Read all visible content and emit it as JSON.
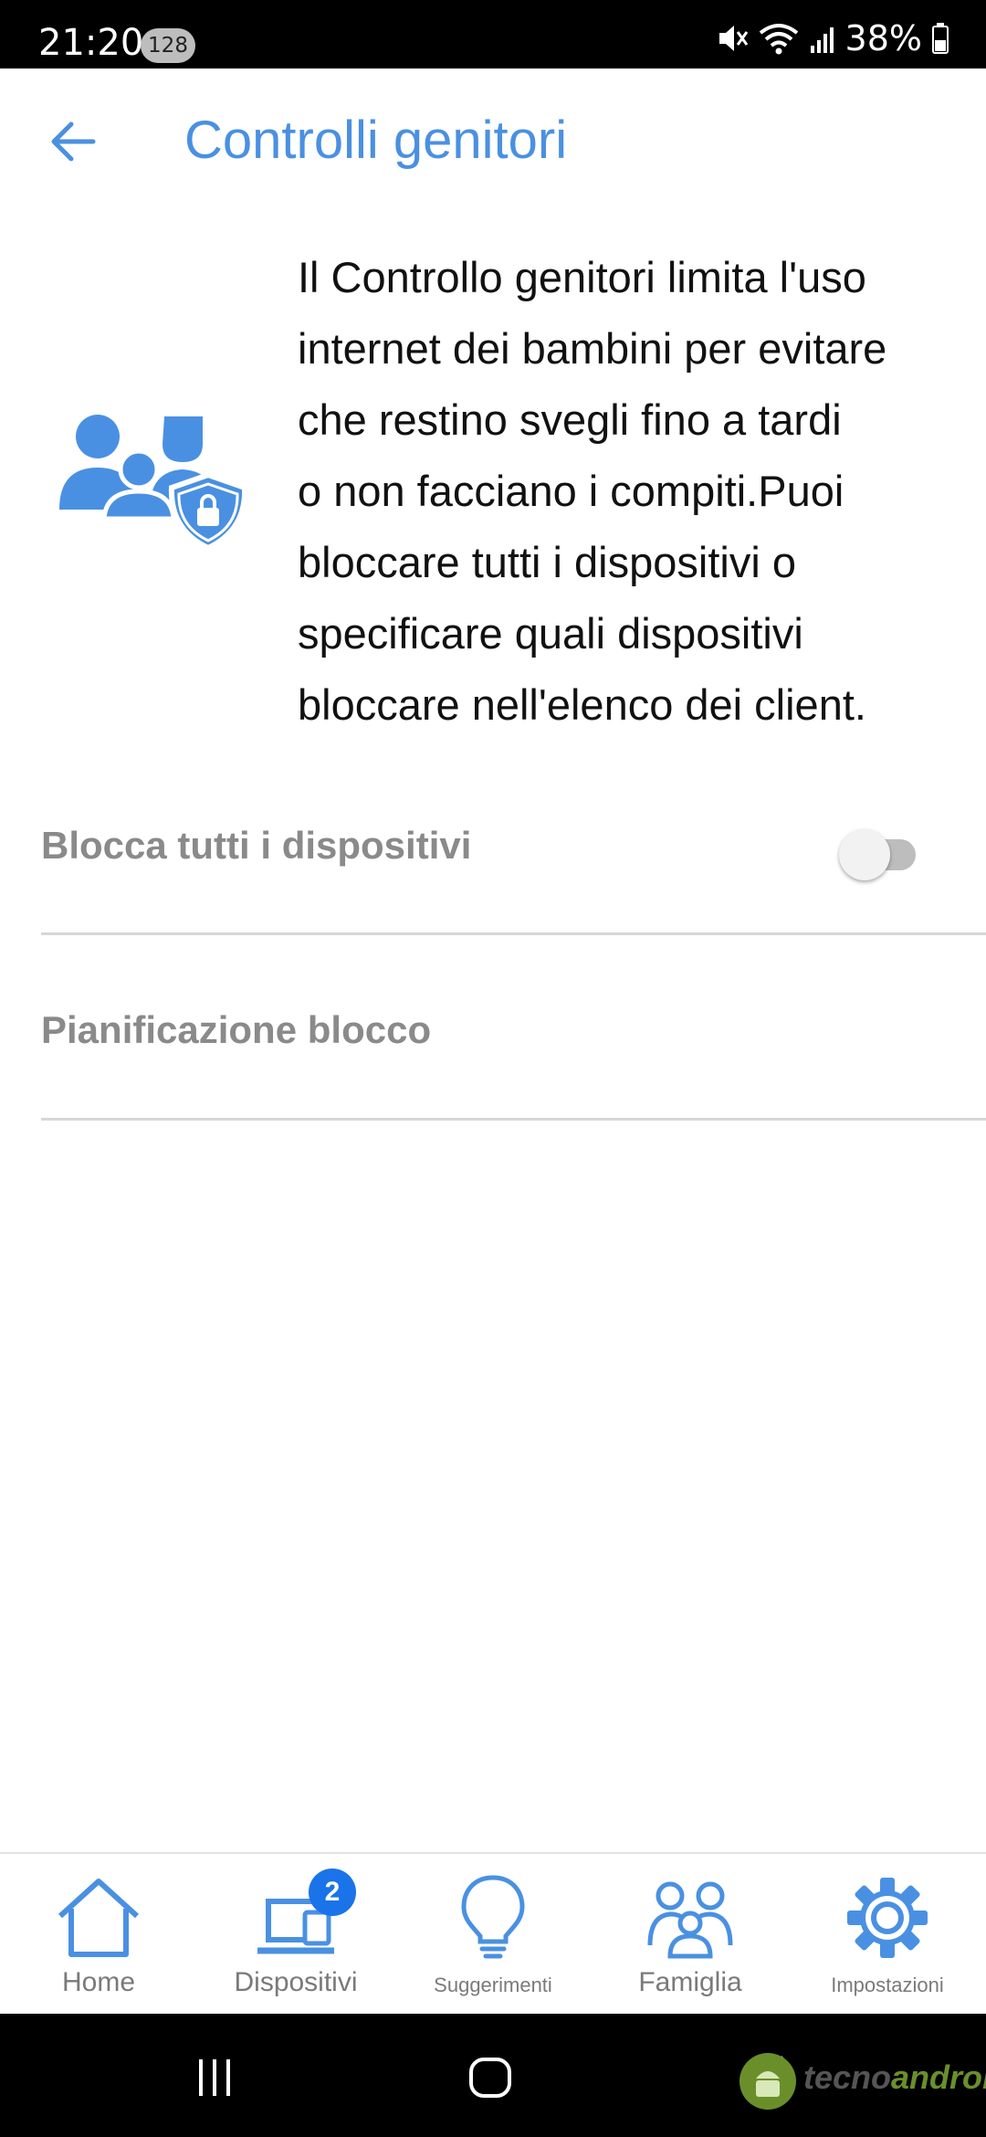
{
  "status_bar": {
    "time": "21:20",
    "badge": "128",
    "battery": "38%"
  },
  "header": {
    "title": "Controlli genitori"
  },
  "intro": {
    "lines": [
      "Il Controllo genitori limita l'uso",
      "internet dei bambini per evitare",
      "che restino svegli fino a tardi",
      "o non facciano i compiti.Puoi",
      "bloccare tutti i dispositivi o",
      "specificare quali dispositivi",
      "bloccare nell'elenco dei client."
    ]
  },
  "settings": {
    "block_all_label": "Blocca tutti i dispositivi",
    "block_all_enabled": false,
    "schedule_label": "Pianificazione blocco"
  },
  "bottom_nav": {
    "items": [
      {
        "label": "Home",
        "icon": "home-icon"
      },
      {
        "label": "Dispositivi",
        "icon": "devices-icon",
        "badge": "2"
      },
      {
        "label": "Suggerimenti",
        "icon": "lightbulb-icon"
      },
      {
        "label": "Famiglia",
        "icon": "family-icon"
      },
      {
        "label": "Impostazioni",
        "icon": "gear-icon"
      }
    ]
  },
  "watermark": {
    "part1": "tecno",
    "part2": "android"
  },
  "colors": {
    "accent": "#4a90e2",
    "badge": "#1a73e8",
    "muted_text": "#8a8a8a"
  }
}
